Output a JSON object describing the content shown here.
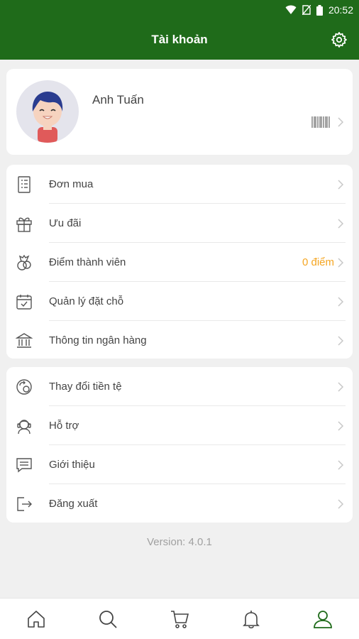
{
  "status_bar": {
    "time": "20:52"
  },
  "header": {
    "title": "Tài khoản",
    "settings_icon": "gear-icon"
  },
  "profile": {
    "name": "Anh Tuấn"
  },
  "menu_group_1": [
    {
      "icon": "receipt-icon",
      "label": "Đơn mua",
      "value": ""
    },
    {
      "icon": "gift-icon",
      "label": "Ưu đãi",
      "value": ""
    },
    {
      "icon": "medal-icon",
      "label": "Điểm thành viên",
      "value": "0 điểm"
    },
    {
      "icon": "calendar-check-icon",
      "label": "Quản lý đặt chỗ",
      "value": ""
    },
    {
      "icon": "bank-icon",
      "label": "Thông tin ngân hàng",
      "value": ""
    }
  ],
  "menu_group_2": [
    {
      "icon": "currency-exchange-icon",
      "label": "Thay đổi tiền tệ"
    },
    {
      "icon": "support-icon",
      "label": "Hỗ trợ"
    },
    {
      "icon": "chat-icon",
      "label": "Giới thiệu"
    },
    {
      "icon": "logout-icon",
      "label": "Đăng xuất"
    }
  ],
  "version": "Version: 4.0.1",
  "colors": {
    "primary": "#1f6b1a",
    "accent": "#f5a623",
    "background": "#f0f0f0"
  },
  "bottom_nav": [
    "home-icon",
    "search-icon",
    "cart-icon",
    "bell-icon",
    "account-icon"
  ]
}
